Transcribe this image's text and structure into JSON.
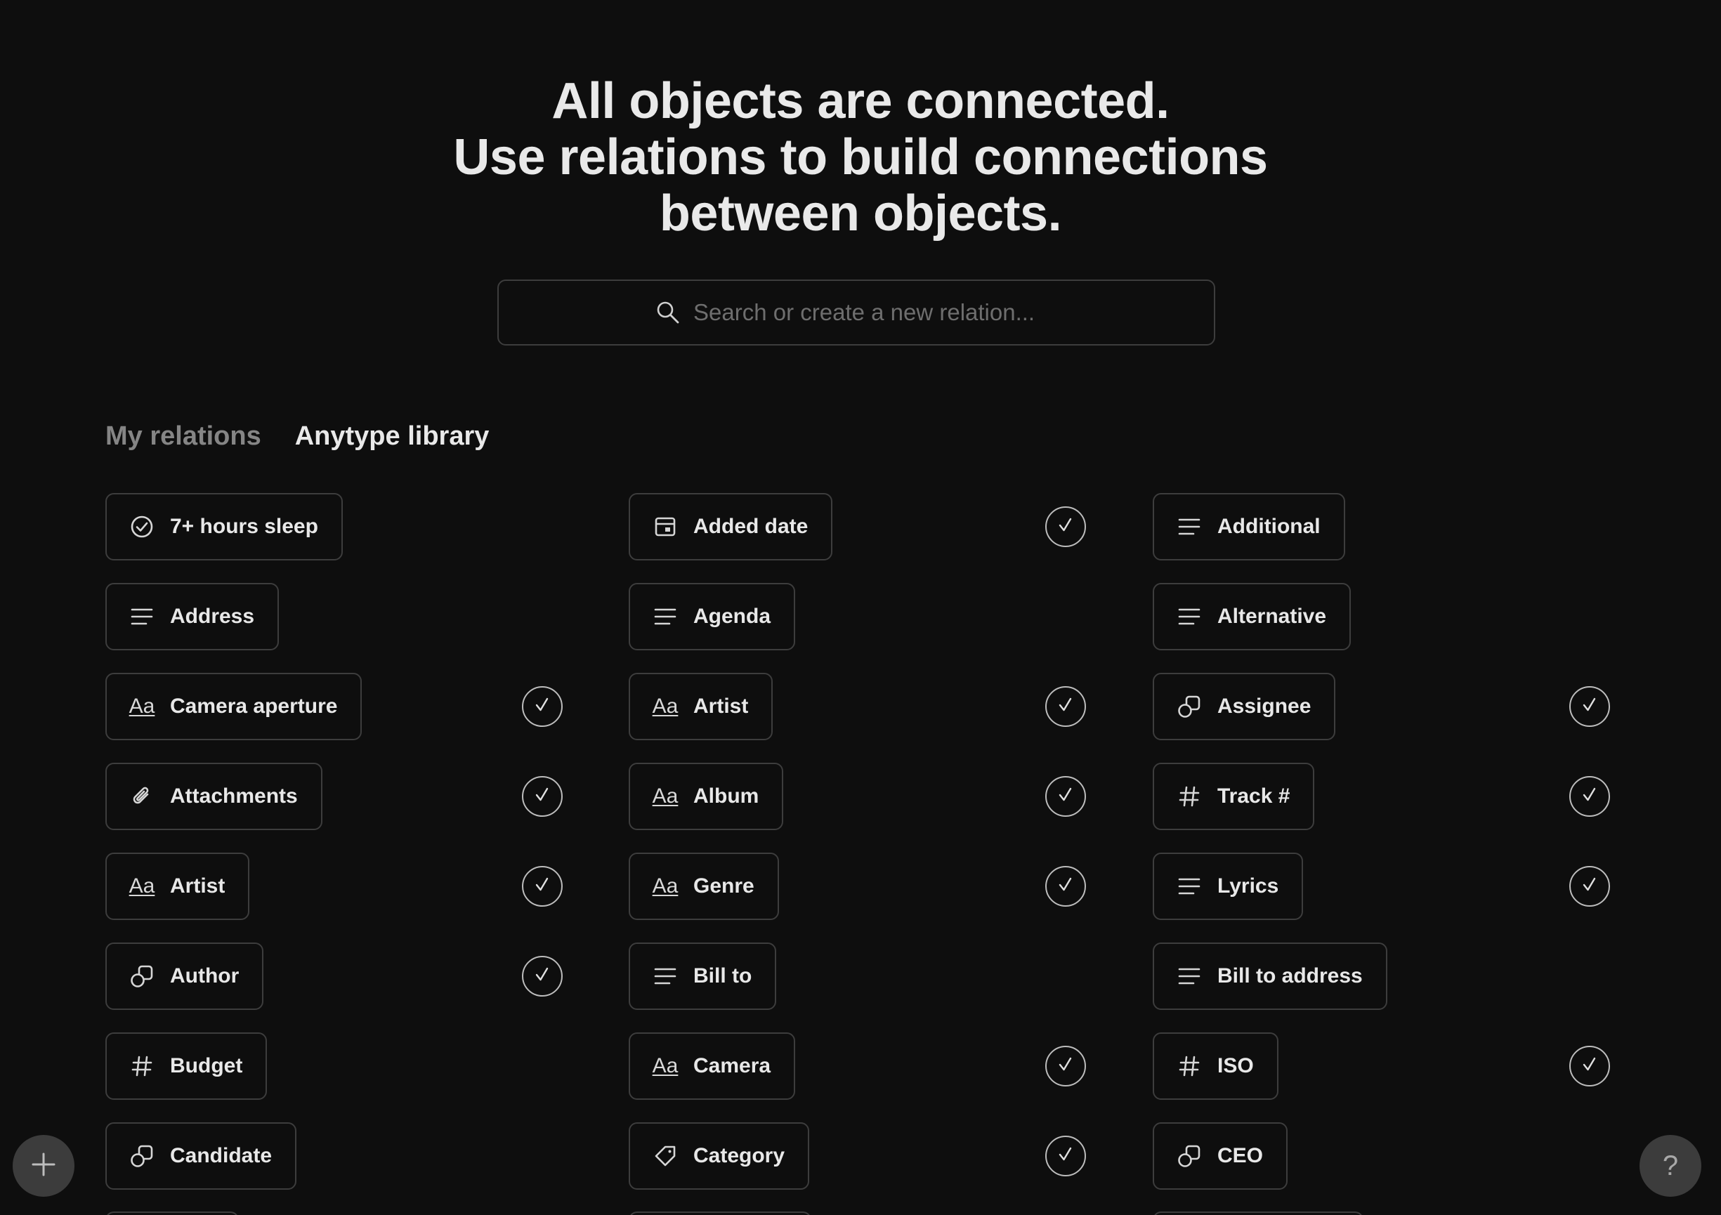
{
  "header": {
    "line1": "All objects are connected.",
    "line2": "Use relations to build connections",
    "line3": "between objects."
  },
  "search": {
    "placeholder": "Search or create a new relation..."
  },
  "tabs": [
    {
      "label": "My relations",
      "active": false
    },
    {
      "label": "Anytype library",
      "active": true
    }
  ],
  "columns": [
    {
      "items": [
        {
          "label": "7+ hours sleep",
          "icon": "checkbox-icon",
          "added": false
        },
        {
          "label": "Address",
          "icon": "text-lines-icon",
          "added": false
        },
        {
          "label": "Camera aperture",
          "icon": "text-aa-icon",
          "added": true
        },
        {
          "label": "Attachments",
          "icon": "paperclip-icon",
          "added": true
        },
        {
          "label": "Artist",
          "icon": "text-aa-icon",
          "added": true
        },
        {
          "label": "Author",
          "icon": "object-icon",
          "added": true
        },
        {
          "label": "Budget",
          "icon": "number-icon",
          "added": false
        },
        {
          "label": "Candidate",
          "icon": "object-icon",
          "added": false
        }
      ]
    },
    {
      "items": [
        {
          "label": "Added date",
          "icon": "calendar-icon",
          "added": true
        },
        {
          "label": "Agenda",
          "icon": "text-lines-icon",
          "added": false
        },
        {
          "label": "Artist",
          "icon": "text-aa-icon",
          "added": true
        },
        {
          "label": "Album",
          "icon": "text-aa-icon",
          "added": true
        },
        {
          "label": "Genre",
          "icon": "text-aa-icon",
          "added": true
        },
        {
          "label": "Bill to",
          "icon": "text-lines-icon",
          "added": false
        },
        {
          "label": "Camera",
          "icon": "text-aa-icon",
          "added": true
        },
        {
          "label": "Category",
          "icon": "tag-icon",
          "added": true
        }
      ]
    },
    {
      "items": [
        {
          "label": "Additional",
          "icon": "text-lines-icon",
          "added": false
        },
        {
          "label": "Alternative",
          "icon": "text-lines-icon",
          "added": false
        },
        {
          "label": "Assignee",
          "icon": "object-icon",
          "added": true
        },
        {
          "label": "Track #",
          "icon": "number-icon",
          "added": true
        },
        {
          "label": "Lyrics",
          "icon": "text-lines-icon",
          "added": true
        },
        {
          "label": "Bill to address",
          "icon": "text-lines-icon",
          "added": false
        },
        {
          "label": "ISO",
          "icon": "number-icon",
          "added": true
        },
        {
          "label": "CEO",
          "icon": "object-icon",
          "added": false
        }
      ]
    }
  ],
  "text_icon_glyph": "Aa",
  "help_glyph": "?",
  "colors": {
    "background": "#0e0e0e",
    "border": "#3d3d3d",
    "text": "#e8e8e8",
    "muted": "#858585",
    "fab": "#3c3c3c"
  }
}
